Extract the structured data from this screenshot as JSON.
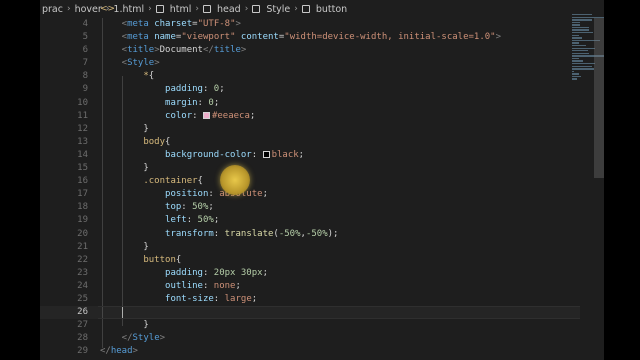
{
  "breadcrumb": [
    "prac",
    "hover",
    "1.html",
    "html",
    "head",
    "Style",
    "button"
  ],
  "lines": [
    {
      "n": "4",
      "t": [
        [
          "t-punct",
          "    <"
        ],
        [
          "t-tag",
          "meta"
        ],
        [
          "t-text",
          " "
        ],
        [
          "t-attr",
          "charset"
        ],
        [
          "t-text",
          "="
        ],
        [
          "t-str",
          "\"UTF-8\""
        ],
        [
          "t-punct",
          ">"
        ]
      ]
    },
    {
      "n": "5",
      "t": [
        [
          "t-punct",
          "    <"
        ],
        [
          "t-tag",
          "meta"
        ],
        [
          "t-text",
          " "
        ],
        [
          "t-attr",
          "name"
        ],
        [
          "t-text",
          "="
        ],
        [
          "t-str",
          "\"viewport\""
        ],
        [
          "t-text",
          " "
        ],
        [
          "t-attr",
          "content"
        ],
        [
          "t-text",
          "="
        ],
        [
          "t-str",
          "\"width=device-width, initial-scale=1.0\""
        ],
        [
          "t-punct",
          ">"
        ]
      ]
    },
    {
      "n": "6",
      "t": [
        [
          "t-punct",
          "    <"
        ],
        [
          "t-tag",
          "title"
        ],
        [
          "t-punct",
          ">"
        ],
        [
          "t-text",
          "Document"
        ],
        [
          "t-punct",
          "</"
        ],
        [
          "t-tag",
          "title"
        ],
        [
          "t-punct",
          ">"
        ]
      ]
    },
    {
      "n": "7",
      "t": [
        [
          "t-punct",
          "    <"
        ],
        [
          "t-tag",
          "Style"
        ],
        [
          "t-punct",
          ">"
        ]
      ]
    },
    {
      "n": "8",
      "t": [
        [
          "t-sel",
          "        *"
        ],
        [
          "t-text",
          "{"
        ]
      ]
    },
    {
      "n": "9",
      "t": [
        [
          "t-prop",
          "            padding"
        ],
        [
          "t-text",
          ": "
        ],
        [
          "t-num",
          "0"
        ],
        [
          "t-text",
          ";"
        ]
      ]
    },
    {
      "n": "10",
      "t": [
        [
          "t-prop",
          "            margin"
        ],
        [
          "t-text",
          ": "
        ],
        [
          "t-num",
          "0"
        ],
        [
          "t-text",
          ";"
        ]
      ]
    },
    {
      "n": "11",
      "t": [
        [
          "t-prop",
          "            color"
        ],
        [
          "t-text",
          ": "
        ],
        [
          "swatch-light",
          ""
        ],
        [
          "t-val",
          "#eeaeca"
        ],
        [
          "t-text",
          ";"
        ]
      ]
    },
    {
      "n": "12",
      "t": [
        [
          "t-text",
          "        }"
        ]
      ]
    },
    {
      "n": "13",
      "t": [
        [
          "t-sel",
          "        body"
        ],
        [
          "t-text",
          "{"
        ]
      ]
    },
    {
      "n": "14",
      "t": [
        [
          "t-prop",
          "            background-color"
        ],
        [
          "t-text",
          ": "
        ],
        [
          "swatch-dark",
          ""
        ],
        [
          "t-val",
          "black"
        ],
        [
          "t-text",
          ";"
        ]
      ]
    },
    {
      "n": "15",
      "t": [
        [
          "t-text",
          "        }"
        ]
      ]
    },
    {
      "n": "16",
      "t": [
        [
          "t-sel",
          "        .container"
        ],
        [
          "t-text",
          "{"
        ]
      ]
    },
    {
      "n": "17",
      "t": [
        [
          "t-prop",
          "            position"
        ],
        [
          "t-text",
          ": "
        ],
        [
          "t-val",
          "absolute"
        ],
        [
          "t-text",
          ";"
        ]
      ]
    },
    {
      "n": "18",
      "t": [
        [
          "t-prop",
          "            top"
        ],
        [
          "t-text",
          ": "
        ],
        [
          "t-num",
          "50%"
        ],
        [
          "t-text",
          ";"
        ]
      ]
    },
    {
      "n": "19",
      "t": [
        [
          "t-prop",
          "            left"
        ],
        [
          "t-text",
          ": "
        ],
        [
          "t-num",
          "50%"
        ],
        [
          "t-text",
          ";"
        ]
      ]
    },
    {
      "n": "20",
      "t": [
        [
          "t-prop",
          "            transform"
        ],
        [
          "t-text",
          ": "
        ],
        [
          "t-fn",
          "translate"
        ],
        [
          "t-text",
          "("
        ],
        [
          "t-num",
          "-50%"
        ],
        [
          "t-text",
          ","
        ],
        [
          "t-num",
          "-50%"
        ],
        [
          "t-text",
          ");"
        ]
      ]
    },
    {
      "n": "21",
      "t": [
        [
          "t-text",
          "        }"
        ]
      ]
    },
    {
      "n": "22",
      "t": [
        [
          "t-sel",
          "        button"
        ],
        [
          "t-text",
          "{"
        ]
      ]
    },
    {
      "n": "23",
      "t": [
        [
          "t-prop",
          "            padding"
        ],
        [
          "t-text",
          ": "
        ],
        [
          "t-num",
          "20px 30px"
        ],
        [
          "t-text",
          ";"
        ]
      ]
    },
    {
      "n": "24",
      "t": [
        [
          "t-prop",
          "            outline"
        ],
        [
          "t-text",
          ": "
        ],
        [
          "t-val",
          "none"
        ],
        [
          "t-text",
          ";"
        ]
      ]
    },
    {
      "n": "25",
      "t": [
        [
          "t-prop",
          "            font-size"
        ],
        [
          "t-text",
          ": "
        ],
        [
          "t-val",
          "large"
        ],
        [
          "t-text",
          ";"
        ]
      ]
    },
    {
      "n": "26",
      "t": [
        [
          "t-text",
          ""
        ]
      ],
      "current": true
    },
    {
      "n": "27",
      "t": [
        [
          "t-text",
          "        }"
        ]
      ]
    },
    {
      "n": "28",
      "t": [
        [
          "t-punct",
          "    </"
        ],
        [
          "t-tag",
          "Style"
        ],
        [
          "t-punct",
          ">"
        ]
      ]
    },
    {
      "n": "29",
      "t": [
        [
          "t-punct",
          "</"
        ],
        [
          "t-tag",
          "head"
        ],
        [
          "t-punct",
          ">"
        ]
      ]
    }
  ],
  "colors": {
    "swatch_light": "#eeaeca",
    "swatch_dark": "#000000"
  }
}
